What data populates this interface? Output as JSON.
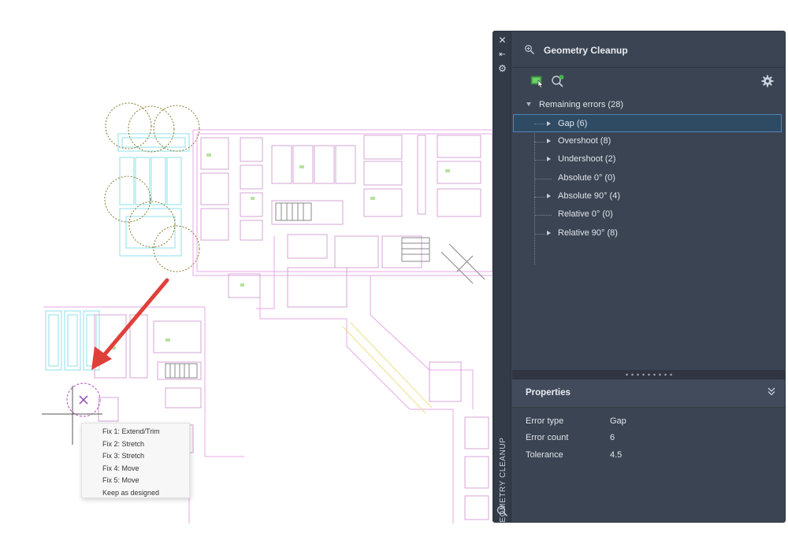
{
  "palette": {
    "title": "Geometry Cleanup",
    "vertical_title": "GEOMETRY CLEANUP",
    "strip_buttons": [
      {
        "icon": "close-icon",
        "glyph": "✕"
      },
      {
        "icon": "auto-hide-icon",
        "glyph": "⇤"
      },
      {
        "icon": "palette-settings-icon",
        "glyph": "⚙"
      }
    ],
    "toolbar": {
      "select_icon": "select-objects-icon",
      "zoom_icon": "zoom-errors-icon",
      "settings_icon": "gear-icon"
    },
    "tree": {
      "root": {
        "label": "Remaining errors (28)"
      },
      "items": [
        {
          "label": "Gap (6)",
          "expandable": true,
          "selected": true
        },
        {
          "label": "Overshoot (8)",
          "expandable": true,
          "selected": false
        },
        {
          "label": "Undershoot (2)",
          "expandable": true,
          "selected": false
        },
        {
          "label": "Absolute 0° (0)",
          "expandable": false,
          "selected": false
        },
        {
          "label": "Absolute 90° (4)",
          "expandable": true,
          "selected": false
        },
        {
          "label": "Relative 0° (0)",
          "expandable": false,
          "selected": false
        },
        {
          "label": "Relative 90° (8)",
          "expandable": true,
          "selected": false
        }
      ]
    },
    "properties": {
      "title": "Properties",
      "rows": [
        {
          "key": "Error type",
          "value": "Gap"
        },
        {
          "key": "Error count",
          "value": "6"
        },
        {
          "key": "Tolerance",
          "value": "4.5"
        }
      ]
    }
  },
  "context_menu": {
    "items": [
      "Fix 1: Extend/Trim",
      "Fix 2: Stretch",
      "Fix 3: Stretch",
      "Fix 4: Move",
      "Fix 5: Move",
      "Keep as designed"
    ]
  },
  "colors": {
    "palette_bg": "#3b4453",
    "selection": "#2f4a63",
    "arrow": "#e0403a",
    "error_circle": "#8a7a2a",
    "gap_marker": "#b34fc0"
  }
}
